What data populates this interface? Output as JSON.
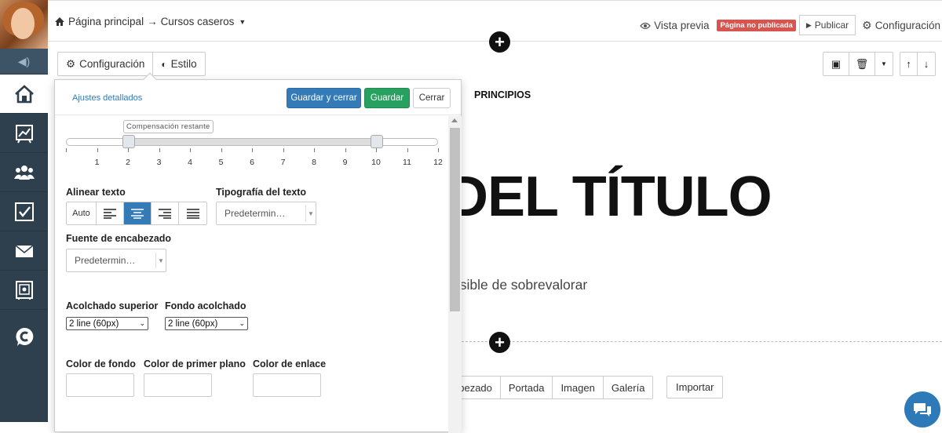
{
  "breadcrumb": {
    "home_label": "Página principal",
    "arrow": "→",
    "current_label": "Cursos caseros",
    "home_icon": "home-icon",
    "dropdown_icon": "caret-down-icon"
  },
  "topbar": {
    "preview_label": "Vista previa",
    "unpublished_badge": "Página no publicada",
    "publish_label": "Publicar",
    "settings_label": "Configuración"
  },
  "section_tabs": {
    "settings_label": "Configuración",
    "style_label": "Estilo"
  },
  "panel": {
    "detailed_settings_label": "Ajustes detallados",
    "save_close_label": "Guardar y cerrar",
    "save_label": "Guardar",
    "close_label": "Cerrar",
    "slider_tooltip": "Compensación restante",
    "slider_ticks": [
      "1",
      "2",
      "3",
      "4",
      "5",
      "6",
      "7",
      "8",
      "9",
      "10",
      "11",
      "12"
    ],
    "slider_range": {
      "start": 2,
      "end": 10
    },
    "align_text_label": "Alinear texto",
    "align_auto_label": "Auto",
    "align_selected": "center",
    "text_font_label": "Tipografía del texto",
    "text_font_value": "Predetermin…",
    "heading_font_label": "Fuente de encabezado",
    "heading_font_value": "Predetermin…",
    "top_padding_label": "Acolchado superior",
    "top_padding_value": "2 line (60px)",
    "bottom_padding_label": "Fondo acolchado",
    "bottom_padding_value": "2 line (60px)",
    "bg_color_label": "Color de fondo",
    "fg_color_label": "Color de primer plano",
    "link_color_label": "Color de enlace"
  },
  "page": {
    "nav_item": "PRINCIPIOS",
    "hero_title": "DEL TÍTULO",
    "hero_subtitle": "osible de sobrevalorar",
    "block_types": [
      "abezado",
      "Portada",
      "Imagen",
      "Galería"
    ],
    "import_label": "Importar"
  },
  "colors": {
    "primary": "#337ab7",
    "success": "#28a060",
    "danger": "#d9534f",
    "rail": "#2e3f4e"
  }
}
